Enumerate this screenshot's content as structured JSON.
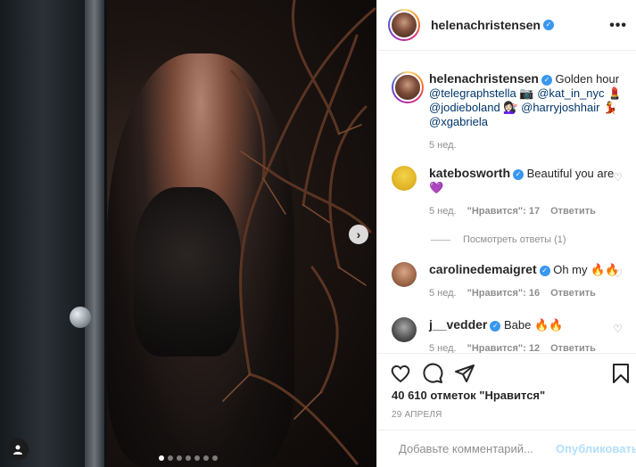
{
  "post": {
    "author": "helenachristensen",
    "more_icon": "more-horizontal-icon",
    "caption_user": "helenachristensen",
    "caption_text": " Golden hour ",
    "caption_tags": [
      {
        "text": "@telegraphstella",
        "after": " 📷 "
      },
      {
        "text": "@kat_in_nyc",
        "after": " 💄 "
      },
      {
        "text": "@jodieboland",
        "after": " 💇🏻‍♀️ "
      },
      {
        "text": "@harryjoshhair",
        "after": " 💃 "
      },
      {
        "text": "@xgabriela",
        "after": ""
      }
    ],
    "caption_time": "5 нед.",
    "likes": "40 610 отметок \"Нравится\"",
    "date": "29 АПРЕЛЯ",
    "carousel_dots": 7,
    "carousel_active": 0
  },
  "comments": [
    {
      "user": "katebosworth",
      "text": " Beautiful you are 💜",
      "time": "5 нед.",
      "likes": "\"Нравится\": 17",
      "reply": "Ответить"
    },
    {
      "user": "carolinedemaigret",
      "text": " Oh my 🔥🔥",
      "time": "5 нед.",
      "likes": "\"Нравится\": 16",
      "reply": "Ответить"
    },
    {
      "user": "j__vedder",
      "text": " Babe 🔥🔥",
      "time": "5 нед.",
      "likes": "\"Нравится\": 12",
      "reply": "Ответить"
    }
  ],
  "view_replies": "Посмотреть ответы (1)",
  "add_comment": {
    "placeholder": "Добавьте комментарий...",
    "post_label": "Опубликовать"
  },
  "colors": {
    "verified": "#3897f0",
    "link": "#00376b",
    "muted": "#8e8e8e",
    "post_disabled": "#b2dffc"
  }
}
